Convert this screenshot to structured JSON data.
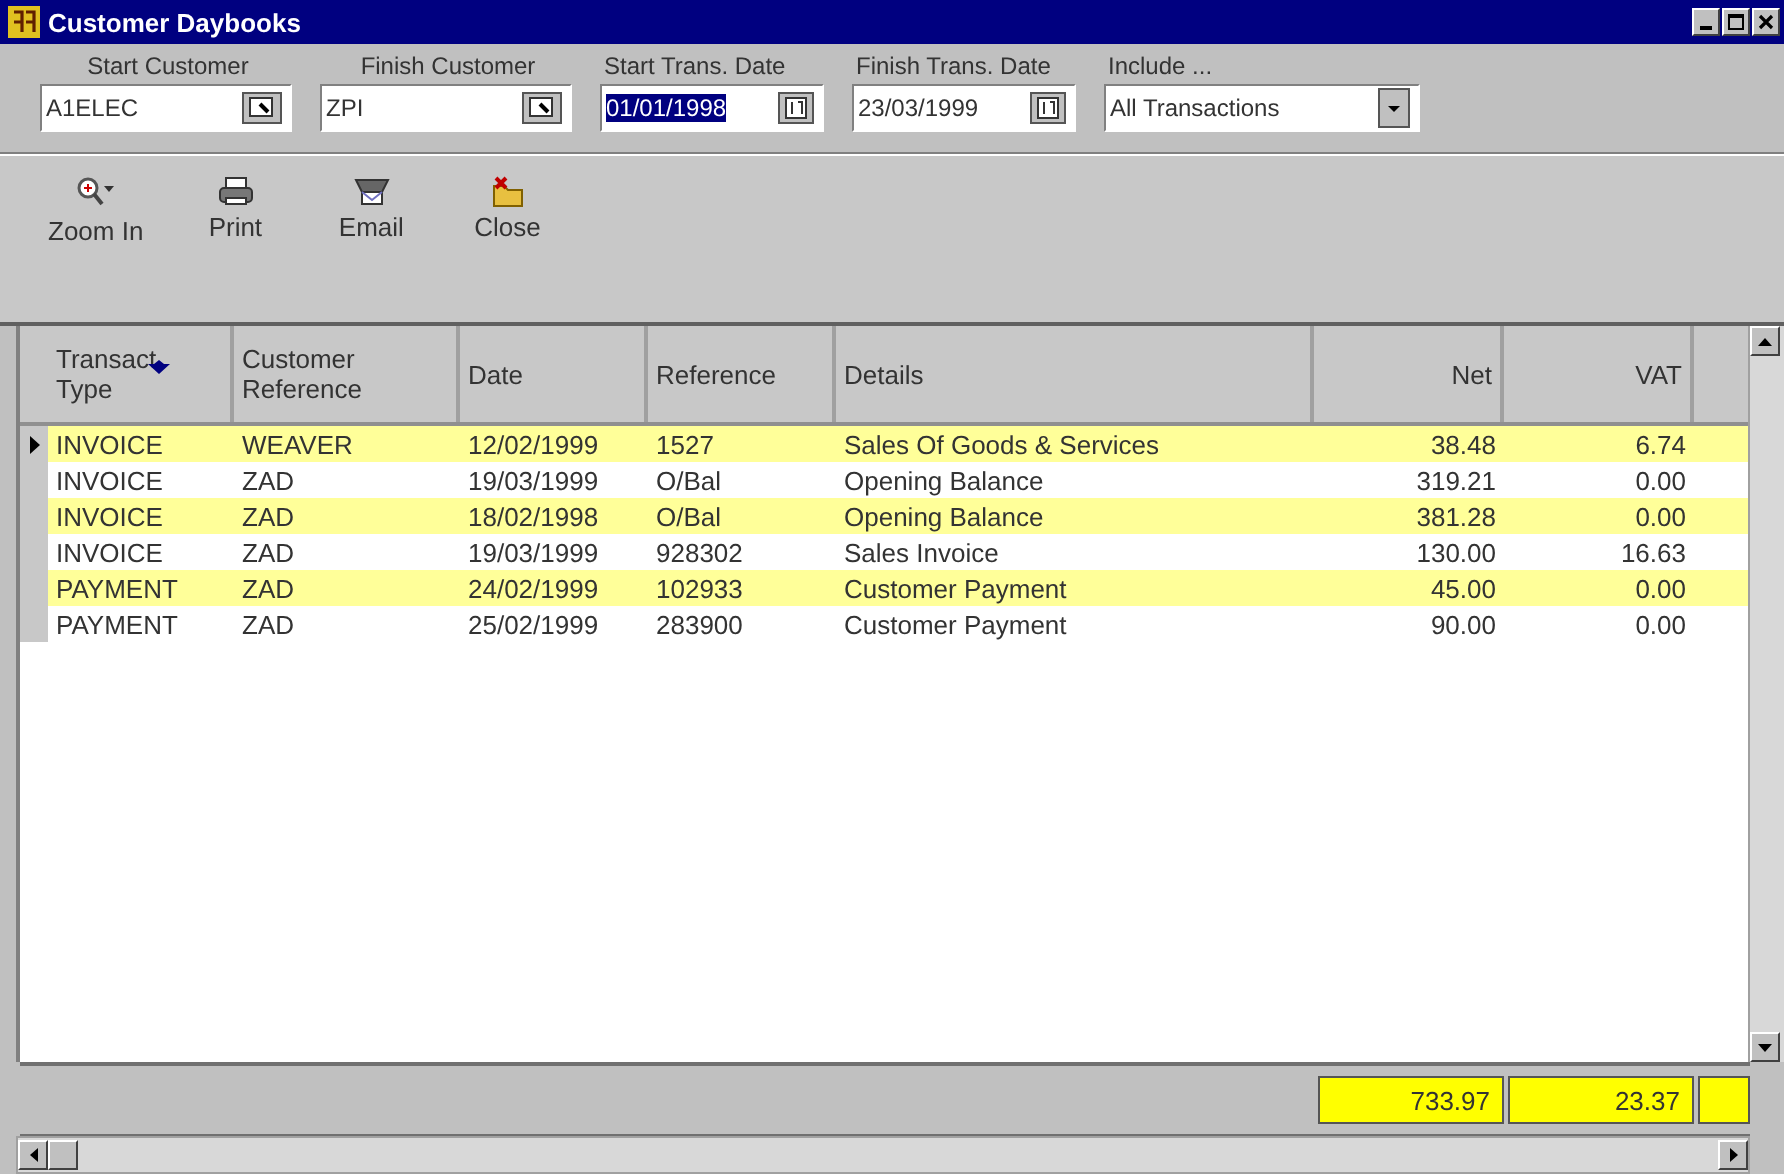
{
  "window": {
    "title": "Customer Daybooks"
  },
  "filters": [
    {
      "label": "Start Customer",
      "value": "A1ELEC",
      "kind": "lookup",
      "selected": false
    },
    {
      "label": "Finish Customer",
      "value": "ZPI",
      "kind": "lookup",
      "selected": false
    },
    {
      "label": "Start Trans. Date",
      "value": "01/01/1998",
      "kind": "date",
      "selected": true
    },
    {
      "label": "Finish Trans. Date",
      "value": "23/03/1999",
      "kind": "date",
      "selected": false
    },
    {
      "label": "Include ...",
      "value": "All Transactions",
      "kind": "dropdown",
      "selected": false
    }
  ],
  "toolbar": [
    {
      "label": "Zoom In",
      "kind": "zoom"
    },
    {
      "label": "Print",
      "kind": "print"
    },
    {
      "label": "Email",
      "kind": "email"
    },
    {
      "label": "Close",
      "kind": "close"
    }
  ],
  "table": {
    "columns": [
      {
        "label": "Transact Type",
        "sorted": true
      },
      {
        "label": "Customer Reference",
        "sorted": false
      },
      {
        "label": "Date",
        "sorted": false
      },
      {
        "label": "Reference",
        "sorted": false
      },
      {
        "label": "Details",
        "sorted": false
      },
      {
        "label": "Net",
        "sorted": false
      },
      {
        "label": "VAT",
        "sorted": false
      }
    ],
    "rows": [
      {
        "cells": [
          "INVOICE",
          "WEAVER",
          "12/02/1999",
          "1527",
          "Sales Of Goods & Services",
          "38.48",
          "6.74"
        ],
        "highlighted": true,
        "current": true
      },
      {
        "cells": [
          "INVOICE",
          "ZAD",
          "19/03/1999",
          "O/Bal",
          "Opening Balance",
          "319.21",
          "0.00"
        ],
        "highlighted": false,
        "current": false
      },
      {
        "cells": [
          "INVOICE",
          "ZAD",
          "18/02/1998",
          "O/Bal",
          "Opening Balance",
          "381.28",
          "0.00"
        ],
        "highlighted": true,
        "current": false
      },
      {
        "cells": [
          "INVOICE",
          "ZAD",
          "19/03/1999",
          "928302",
          "Sales Invoice",
          "130.00",
          "16.63"
        ],
        "highlighted": false,
        "current": false
      },
      {
        "cells": [
          "PAYMENT",
          "ZAD",
          "24/02/1999",
          "102933",
          "Customer Payment",
          "45.00",
          "0.00"
        ],
        "highlighted": true,
        "current": false
      },
      {
        "cells": [
          "PAYMENT",
          "ZAD",
          "25/02/1999",
          "283900",
          "Customer Payment",
          "90.00",
          "0.00"
        ],
        "highlighted": false,
        "current": false
      }
    ],
    "totals": [
      "733.97",
      "23.37"
    ]
  }
}
